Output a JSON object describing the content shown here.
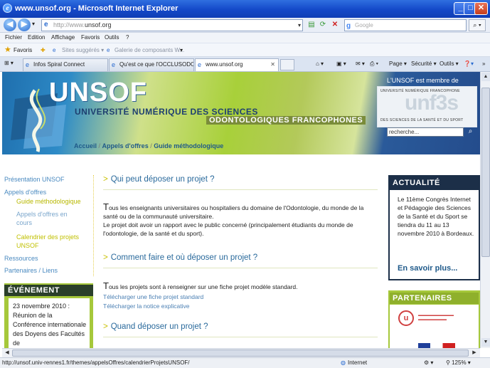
{
  "window": {
    "title": "www.unsof.org - Microsoft Internet Explorer"
  },
  "address": {
    "prefix": "http://www.",
    "domain": "unsof.org"
  },
  "search_bar": {
    "placeholder": "Google"
  },
  "menu": [
    "Fichier",
    "Edition",
    "Affichage",
    "Favoris",
    "Outils",
    "?"
  ],
  "favorites": {
    "label": "Favoris",
    "items": [
      "Sites suggérés ▾",
      "Galerie de composants W..."
    ]
  },
  "tabs": [
    {
      "label": "Infos Spiral Connect",
      "active": false
    },
    {
      "label": "Qu'est ce que l'OCCLUSODO...",
      "active": false
    },
    {
      "label": "www.unsof.org",
      "active": true
    }
  ],
  "commands": [
    "Page ▾",
    "Sécurité ▾",
    "Outils ▾"
  ],
  "site": {
    "logo": "UNSOF",
    "tagline1": "UNIVERSITÉ NUMÉRIQUE DES SCIENCES",
    "tagline2": "ODONTOLOGIQUES FRANCOPHONES",
    "member_title": "L'UNSOF est membre de",
    "member_line1": "UNIVERSITÉ NUMÉRIQUE FRANCOPHONE",
    "member_big": "unf3s",
    "member_line2": "DES SCIENCES DE LA SANTÉ ET DU SPORT",
    "search_value": "recherche..."
  },
  "breadcrumb": [
    "Accueil",
    "Appels d'offres",
    "Guide méthodologique"
  ],
  "nav": {
    "presentation": "Présentation UNSOF",
    "appels": "Appels d'offres",
    "guide": "Guide méthodologique",
    "appels_cours": "Appels d'offres en cours",
    "calendrier": "Calendrier des projets UNSOF",
    "ressources": "Ressources",
    "partenaires": "Partenaires / Liens"
  },
  "event": {
    "title": "ÉVÉNEMENT",
    "text": "23 novembre 2010 : Réunion de la Conférence internationale des Doyens des Facultés de"
  },
  "main": {
    "s1_title": "Qui peut déposer un projet ?",
    "s1_cap": "T",
    "s1_p1": "ous les enseignants universitaires ou hospitaliers du domaine de l'Odontologie, du monde de la santé ou de la communauté universitaire.",
    "s1_p2": "Le projet doit avoir un rapport avec le public concerné (principalement étudiants du monde de l'odontologie, de la santé et du sport).",
    "s2_title": "Comment faire et où déposer un projet ?",
    "s2_cap": "T",
    "s2_p1": "ous les projets sont à renseigner sur une fiche projet modèle standard.",
    "link1": "Télécharger une fiche projet standard",
    "link2": "Télécharger la notice explicative",
    "s3_title": "Quand déposer un projet ?"
  },
  "actu": {
    "title": "ACTUALITÉ",
    "text": "Le 11ème Congrès Internet et Pédagogie des Sciences de la Santé et du Sport se tiendra du 11 au 13 novembre 2010 à Bordeaux.",
    "more": "En savoir plus..."
  },
  "partners": {
    "title": "PARTENAIRES"
  },
  "status": {
    "url": "http://unsof.univ-rennes1.fr/themes/appelsOffres/calendrierProjetsUNSOF/",
    "zone": "Internet",
    "zoom": "125%"
  }
}
